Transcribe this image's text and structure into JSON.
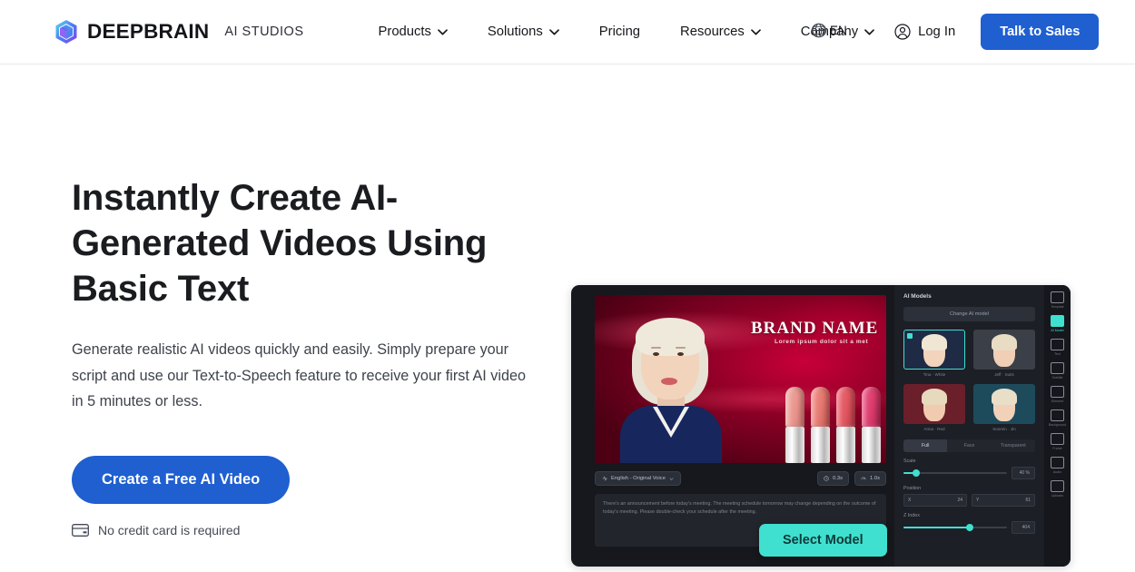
{
  "header": {
    "brand_name": "DEEPBRAIN",
    "brand_sub": "AI STUDIOS",
    "logo_icon": "cube-logo-icon",
    "nav": [
      {
        "label": "Products",
        "has_dropdown": true
      },
      {
        "label": "Solutions",
        "has_dropdown": true
      },
      {
        "label": "Pricing",
        "has_dropdown": false
      },
      {
        "label": "Resources",
        "has_dropdown": true
      },
      {
        "label": "Company",
        "has_dropdown": true
      }
    ],
    "language": {
      "label": "EN",
      "icon": "globe-icon"
    },
    "login": {
      "label": "Log In",
      "icon": "user-circle-icon"
    },
    "cta": {
      "label": "Talk to Sales"
    }
  },
  "hero": {
    "title": "Instantly Create AI-Generated Videos Using Basic Text",
    "subtitle": "Generate realistic AI videos quickly and easily. Simply prepare your script and use our Text-to-Speech feature to receive your first AI video in 5 minutes or less.",
    "cta_label": "Create a Free AI Video",
    "note": "No credit card is required",
    "note_icon": "credit-card-icon"
  },
  "preview": {
    "stage": {
      "brand_title": "BRAND NAME",
      "brand_tagline": "Lorem ipsum dolor sit a met",
      "lipstick_colors": [
        "#e8948c",
        "#e4776f",
        "#e0555f",
        "#d93b6a"
      ]
    },
    "toolbar": {
      "voice_pill": "English - Original Voice",
      "voice_icon": "sound-wave-icon",
      "duration_pill": "0.3s",
      "duration_icon": "clock-icon",
      "speed_pill": "1.0x",
      "speed_icon": "gauge-icon"
    },
    "script": "There's an announcement before today's meeting. The meeting schedule tomorrow may change depending on the outcome of today's meeting. Please double-check your schedule after the meeting.",
    "select_model_label": "Select Model",
    "panel": {
      "title": "AI Models",
      "change_button": "Change AI model",
      "models": [
        {
          "label": "Tina · White",
          "selected": true,
          "bg": "#1f2a44",
          "hair": "#efe6d4",
          "skin": "#f2d3bc"
        },
        {
          "label": "Jeff · Suits",
          "selected": false,
          "bg": "#3a3f48",
          "hair": "#e8dcc4",
          "skin": "#f0cfb6"
        },
        {
          "label": "Anna · Red",
          "selected": false,
          "bg": "#6b1f2a",
          "hair": "#e6d9bc",
          "skin": "#f0cbb0"
        },
        {
          "label": "Soomin · Jin",
          "selected": false,
          "bg": "#1d4b5c",
          "hair": "#e9dfc8",
          "skin": "#f1d2b9"
        }
      ],
      "tabs": [
        "Full",
        "Face",
        "Transparent"
      ],
      "active_tab": "Full",
      "scale": {
        "label": "Scale",
        "value": "40 %",
        "percent": 12
      },
      "position": {
        "label": "Position",
        "x_axis": "X",
        "x_value": "24",
        "y_axis": "Y",
        "y_value": "61"
      },
      "zindex": {
        "label": "Z Index",
        "value": "404",
        "percent": 64
      }
    },
    "rail": [
      {
        "label": "Template",
        "icon": "template-icon",
        "active": false
      },
      {
        "label": "AI Model",
        "icon": "ai-model-icon",
        "active": true
      },
      {
        "label": "Text",
        "icon": "text-icon",
        "active": false
      },
      {
        "label": "Subtitle",
        "icon": "subtitle-icon",
        "active": false
      },
      {
        "label": "Element",
        "icon": "element-icon",
        "active": false
      },
      {
        "label": "Background",
        "icon": "background-icon",
        "active": false
      },
      {
        "label": "Frame",
        "icon": "frame-icon",
        "active": false
      },
      {
        "label": "Audio",
        "icon": "audio-icon",
        "active": false
      },
      {
        "label": "Uploads",
        "icon": "uploads-icon",
        "active": false
      }
    ],
    "cursor_icon": "mouse-pointer-icon"
  },
  "colors": {
    "brand_blue": "#1f5fd0",
    "accent_teal": "#3fe0d0",
    "text_dark": "#1a1c20",
    "app_dark": "#16181d"
  }
}
